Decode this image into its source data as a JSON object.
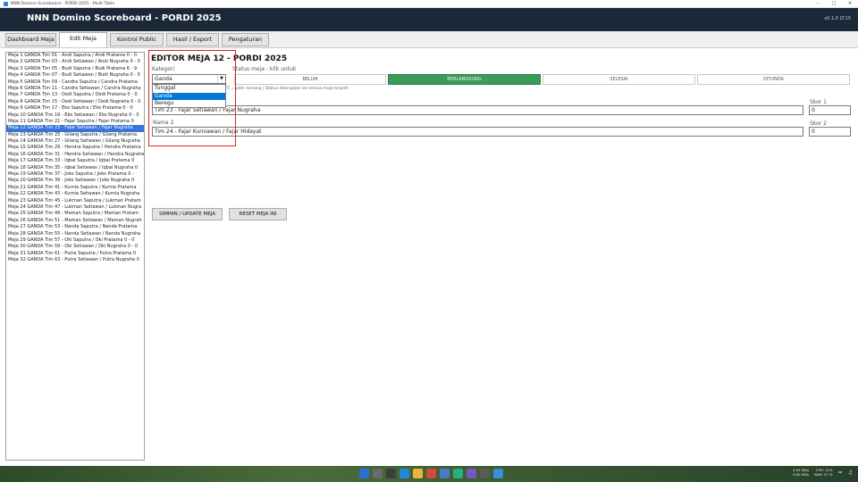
{
  "window": {
    "title": "NNN Domino Scoreboard - PORDI 2025 - Multi Table"
  },
  "header": {
    "title": "NNN Domino Scoreboard - PORDI 2025",
    "version": "v0.1.0 LT.15"
  },
  "tabs": [
    {
      "label": "Dashboard Meja"
    },
    {
      "label": "Edit Meja"
    },
    {
      "label": "Kontrol Public"
    },
    {
      "label": "Hasil / Export"
    },
    {
      "label": "Pengaturan"
    }
  ],
  "meja_list": [
    "Meja 1   GANDA   Tim 01 - Andi Saputra / Andi Pratama  0 - 0",
    "Meja 2   GANDA   Tim 03 - Andi Setiawan / Andi Nugraha  0 - 0",
    "Meja 3   GANDA   Tim 05 - Budi Saputra / Budi Pratama  6 - 9",
    "Meja 4   GANDA   Tim 07 - Budi Setiawan / Budi Nugraha  0 - 0",
    "Meja 5   GANDA   Tim 09 - Candra Saputra / Candra Pratama",
    "Meja 6   GANDA   Tim 11 - Candra Setiawan / Candra Nugraha",
    "Meja 7   GANDA   Tim 13 - Dedi Saputra / Dedi Pratama  0 - 0",
    "Meja 8   GANDA   Tim 15 - Dedi Setiawan / Dedi Nugraha  0 - 0",
    "Meja 9   GANDA   Tim 17 - Eko Saputra / Eko Pratama  0 - 0",
    "Meja 10   GANDA   Tim 19 - Eko Setiawan / Eko Nugraha  0 - 0",
    "Meja 11   GANDA   Tim 21 - Fajar Saputra / Fajar Pratama  0",
    "Meja 12   GANDA   Tim 23 - Fajar Setiawan / Fajar Nugraha",
    "Meja 13   GANDA   Tim 25 - Gilang Saputra / Gilang Pratama",
    "Meja 14   GANDA   Tim 27 - Gilang Setiawan / Gilang Nugraha",
    "Meja 15   GANDA   Tim 29 - Hendra Saputra / Hendra Pratama",
    "Meja 16   GANDA   Tim 31 - Hendra Setiawan / Hendra Nugraha",
    "Meja 17   GANDA   Tim 33 - Iqbal Saputra / Iqbal Pratama  0",
    "Meja 18   GANDA   Tim 35 - Iqbal Setiawan / Iqbal Nugraha  0",
    "Meja 19   GANDA   Tim 37 - Joko Saputra / Joko Pratama  0 -",
    "Meja 20   GANDA   Tim 39 - Joko Setiawan / Joko Nugraha  0",
    "Meja 21   GANDA   Tim 41 - Kurnia Saputra / Kurnia Pratama",
    "Meja 22   GANDA   Tim 43 - Kurnia Setiawan / Kurnia Nugraha",
    "Meja 23   GANDA   Tim 45 - Lukman Saputra / Lukman Pratam",
    "Meja 24   GANDA   Tim 47 - Lukman Setiawan / Lukman Nugra",
    "Meja 25   GANDA   Tim 49 - Maman Saputra / Maman Pratam",
    "Meja 26   GANDA   Tim 51 - Maman Setiawan / Maman Nugrah",
    "Meja 27   GANDA   Tim 53 - Nanda Saputra / Nanda Pratama",
    "Meja 28   GANDA   Tim 55 - Nanda Setiawan / Nanda Nugraha",
    "Meja 29   GANDA   Tim 57 - Oki Saputra / Oki Pratama  0 - 0",
    "Meja 30   GANDA   Tim 59 - Oki Setiawan / Oki Nugraha  0 - 0",
    "Meja 31   GANDA   Tim 61 - Putra Saputra / Putra Pratama  0",
    "Meja 32   GANDA   Tim 63 - Putra Setiawan / Putra Nugraha  0"
  ],
  "selected_meja_index": 11,
  "editor": {
    "title": "EDITOR MEJA 12 - PORDI 2025",
    "kategori_label": "Kategori",
    "kategori_value": "Ganda",
    "kategori_options": [
      "Tunggal",
      "Ganda",
      "Beregu"
    ],
    "selected_option_index": 1,
    "status_label": "Status meja - klik untuk",
    "status_buttons": [
      "BELUM",
      "BERLANGSUNG",
      "SELESAI",
      "DITUNDA"
    ],
    "active_status_index": 1,
    "hint": "FT = pilih rentang | Status diterapkan ke semua meja terpilih",
    "nama1_value": "Tim 23 - Fajar Setiawan / Fajar Nugraha",
    "nama2_label": "Nama 2",
    "nama2_value": "Tim 24 - Fajar Kurniawan / Fajar Hidayat",
    "skor1_label": "Skor 1",
    "skor1_value": "0",
    "skor2_label": "Skor 2",
    "skor2_value": "0",
    "save_button": "SIMPAN / UPDATE MEJA",
    "reset_button": "RESET MEJA INI"
  },
  "taskbar": {
    "net_up": "4.94 KB/s",
    "net_down": "0.60 KB/s",
    "cpu": "CPU: 11%",
    "ram": "RAM: 27 %"
  },
  "colors": {
    "header_bg": "#1b2838",
    "active_status": "#3b9a5c",
    "selection": "#3875d7",
    "highlight_box": "#e02020"
  }
}
